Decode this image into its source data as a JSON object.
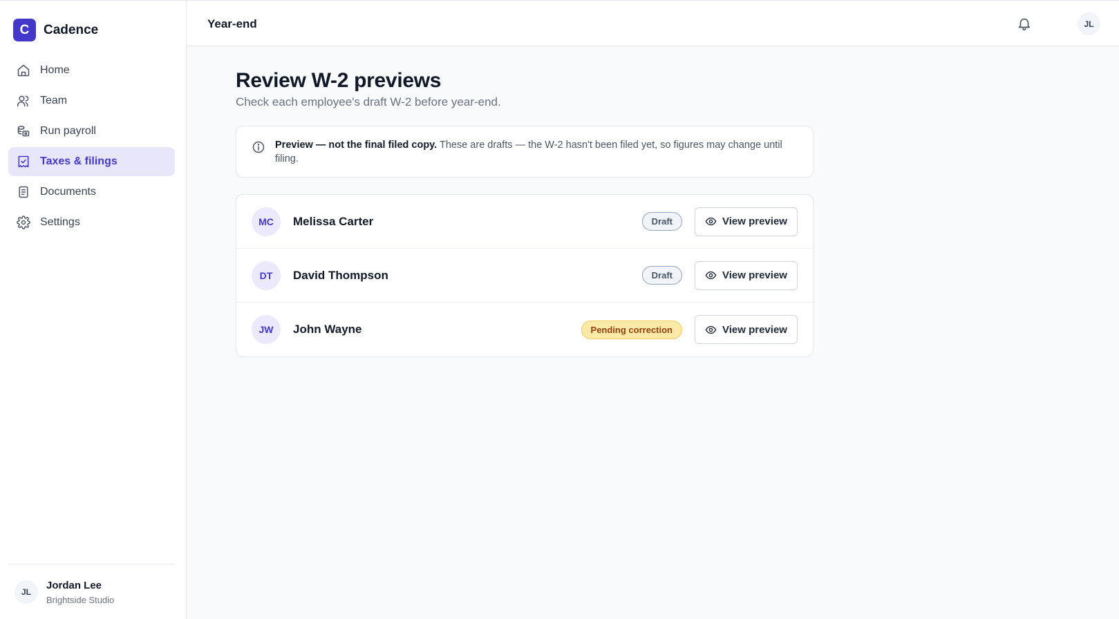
{
  "brand": {
    "logo_letter": "C",
    "name": "Cadence",
    "accent": "#4338ca"
  },
  "sidebar": {
    "items": [
      {
        "label": "Home",
        "icon": "home-icon"
      },
      {
        "label": "Team",
        "icon": "users-icon"
      },
      {
        "label": "Run payroll",
        "icon": "coins-icon"
      },
      {
        "label": "Taxes & filings",
        "icon": "receipt-check-icon",
        "active": true
      },
      {
        "label": "Documents",
        "icon": "document-icon"
      },
      {
        "label": "Settings",
        "icon": "gear-icon"
      }
    ],
    "user": {
      "initials": "JL",
      "name": "Jordan Lee",
      "org": "Brightside Studio"
    }
  },
  "header": {
    "title": "Year-end",
    "user_initials": "JL",
    "notification_icon": "bell-icon"
  },
  "main": {
    "title": "Review W-2 previews",
    "subtitle": "Check each employee's draft W-2 before year-end.",
    "notice": {
      "icon": "info-icon",
      "bold": "Preview — not the final filed copy.",
      "text": " These are drafts — the W-2 hasn't been filed yet, so figures may change until filing."
    },
    "employees": [
      {
        "initials": "MC",
        "name": "Melissa Carter",
        "status": "Draft",
        "action": "View preview"
      },
      {
        "initials": "DT",
        "name": "David Thompson",
        "status": "Draft",
        "action": "View preview"
      },
      {
        "initials": "JW",
        "name": "John Wayne",
        "status": "Pending correction",
        "action": "View preview"
      }
    ]
  }
}
